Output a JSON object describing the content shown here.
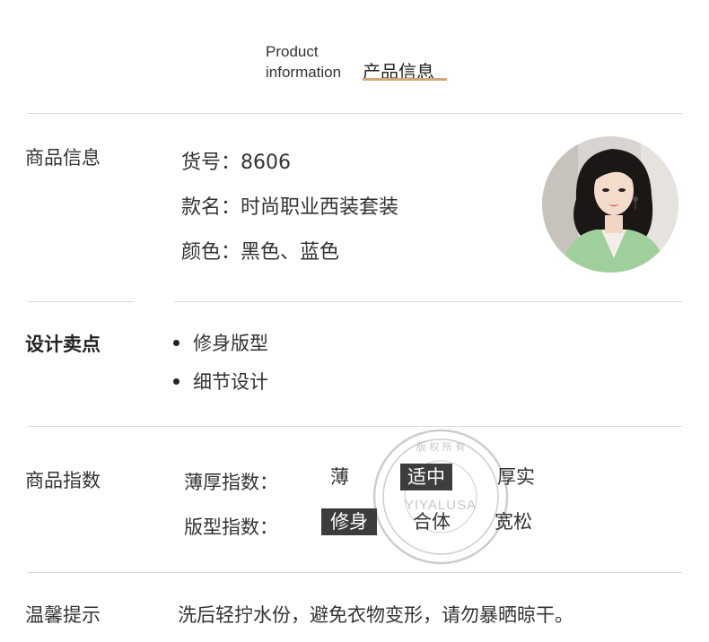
{
  "header": {
    "en_line1": "Product",
    "en_line2": "information",
    "zh": "产品信息"
  },
  "product_info": {
    "title": "商品信息",
    "sku": "货号：8606",
    "style_name": "款名：时尚职业西装套装",
    "color": "颜色：黑色、蓝色"
  },
  "design": {
    "title": "设计卖点",
    "points": [
      "修身版型",
      "细节设计"
    ]
  },
  "index": {
    "title": "商品指数",
    "thickness": {
      "label": "薄厚指数：",
      "options": [
        "薄",
        "适中",
        "厚实"
      ],
      "selected": "适中"
    },
    "fit": {
      "label": "版型指数：",
      "options": [
        "修身",
        "合体",
        "宽松"
      ],
      "selected": "修身"
    }
  },
  "tips": {
    "title": "温馨提示",
    "text": "洗后轻拧水份，避免衣物变形，请勿暴晒晾干。"
  },
  "watermark": {
    "brand": "YIYALUSA",
    "ring_text": "版 权 所 有",
    "colors": {
      "stamp": "#8a8a8a"
    }
  },
  "colors": {
    "accent_underline": "#d4a77a",
    "selected_bg": "#3d3d3d",
    "divider": "#d9d9d9"
  }
}
